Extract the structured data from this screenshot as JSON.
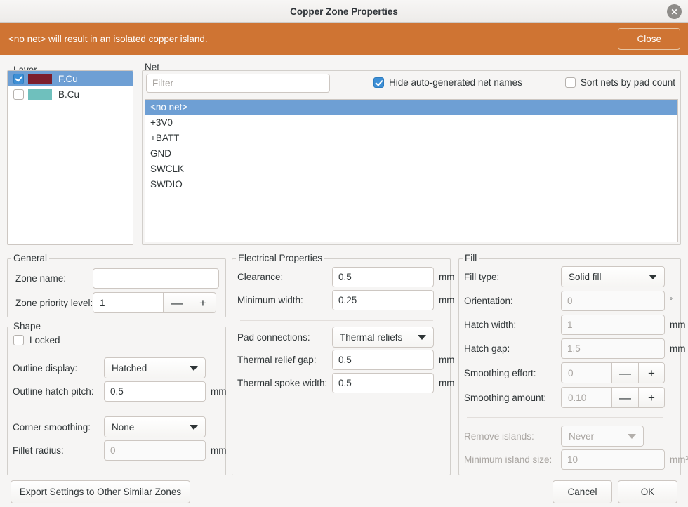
{
  "window": {
    "title": "Copper Zone Properties",
    "close_icon": "close-icon"
  },
  "infobar": {
    "message": "<no net> will result in an isolated copper island.",
    "close_label": "Close",
    "color": "#cf7433"
  },
  "layer": {
    "legend": "Layer",
    "items": [
      {
        "label": "F.Cu",
        "color": "#7c1f2d",
        "checked": true,
        "selected": true
      },
      {
        "label": "B.Cu",
        "color": "#6fc0bd",
        "checked": false,
        "selected": false
      }
    ]
  },
  "net": {
    "legend": "Net",
    "filter_placeholder": "Filter",
    "filter_value": "",
    "hide_auto_label": "Hide auto-generated net names",
    "hide_auto_checked": true,
    "sort_by_pad_label": "Sort nets by pad count",
    "sort_by_pad_checked": false,
    "items": [
      "<no net>",
      "+3V0",
      "+BATT",
      "GND",
      "SWCLK",
      "SWDIO"
    ],
    "selected_index": 0,
    "selection_color": "#6e9fd4"
  },
  "general": {
    "legend": "General",
    "zone_name_label": "Zone name:",
    "zone_name_value": "",
    "priority_label": "Zone priority level:",
    "priority_value": "1",
    "minus_label": "—",
    "plus_label": "+"
  },
  "shape": {
    "legend": "Shape",
    "locked_label": "Locked",
    "locked_checked": false,
    "outline_display_label": "Outline display:",
    "outline_display_value": "Hatched",
    "hatch_pitch_label": "Outline hatch pitch:",
    "hatch_pitch_value": "0.5",
    "hatch_pitch_unit": "mm",
    "corner_smoothing_label": "Corner smoothing:",
    "corner_smoothing_value": "None",
    "fillet_radius_label": "Fillet radius:",
    "fillet_radius_value": "0",
    "fillet_radius_unit": "mm"
  },
  "electrical": {
    "legend": "Electrical Properties",
    "clearance_label": "Clearance:",
    "clearance_value": "0.5",
    "clearance_unit": "mm",
    "min_width_label": "Minimum width:",
    "min_width_value": "0.25",
    "min_width_unit": "mm",
    "pad_conn_label": "Pad connections:",
    "pad_conn_value": "Thermal reliefs",
    "thermal_gap_label": "Thermal relief gap:",
    "thermal_gap_value": "0.5",
    "thermal_gap_unit": "mm",
    "spoke_width_label": "Thermal spoke width:",
    "spoke_width_value": "0.5",
    "spoke_width_unit": "mm"
  },
  "fill": {
    "legend": "Fill",
    "fill_type_label": "Fill type:",
    "fill_type_value": "Solid fill",
    "orientation_label": "Orientation:",
    "orientation_value": "0",
    "orientation_unit": "°",
    "hatch_width_label": "Hatch width:",
    "hatch_width_value": "1",
    "hatch_width_unit": "mm",
    "hatch_gap_label": "Hatch gap:",
    "hatch_gap_value": "1.5",
    "hatch_gap_unit": "mm",
    "smoothing_effort_label": "Smoothing effort:",
    "smoothing_effort_value": "0",
    "smoothing_amount_label": "Smoothing amount:",
    "smoothing_amount_value": "0.10",
    "minus_label": "—",
    "plus_label": "+",
    "remove_islands_label": "Remove islands:",
    "remove_islands_value": "Never",
    "min_island_label": "Minimum island size:",
    "min_island_value": "10",
    "min_island_unit": "mm²"
  },
  "footer": {
    "export_label": "Export Settings to Other Similar Zones",
    "cancel_label": "Cancel",
    "ok_label": "OK"
  }
}
